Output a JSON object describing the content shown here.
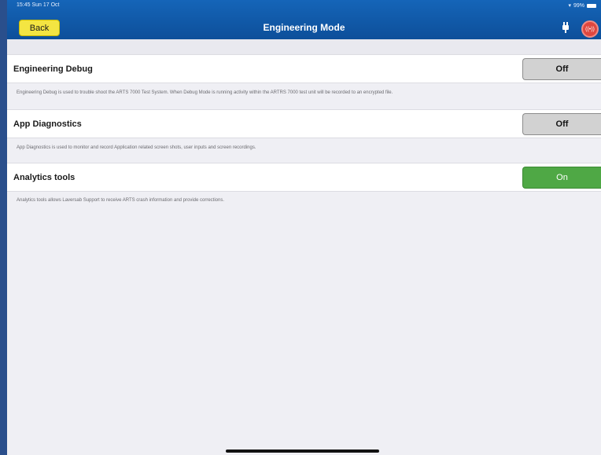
{
  "status_bar": {
    "time": "15:45  Sun 17 Oct",
    "battery": "99%"
  },
  "header": {
    "back_label": "Back",
    "title": "Engineering Mode",
    "icons": [
      "plug-icon",
      "alarm-icon"
    ]
  },
  "settings": [
    {
      "label": "Engineering Debug",
      "state": "Off",
      "description": "Engineering Debug is used to trouble shoot the ARTS 7000 Test System. When Debug Mode is running activity within the ARTRS 7000 test unit will be recorded to an encrypted file."
    },
    {
      "label": "App Diagnostics",
      "state": "Off",
      "description": "App Diagnostics is used to monitor and record Application related screen shots, user inputs and screen recordings."
    },
    {
      "label": "Analytics tools",
      "state": "On",
      "description": "Analytics tools allows Laversab Support to receive ARTS crash information and provide corrections."
    }
  ],
  "colors": {
    "header": "#0f5aa9",
    "back_button": "#f4e542",
    "toggle_on": "#4fa845",
    "toggle_off": "#d2d2d2",
    "alarm": "#e0473f"
  }
}
